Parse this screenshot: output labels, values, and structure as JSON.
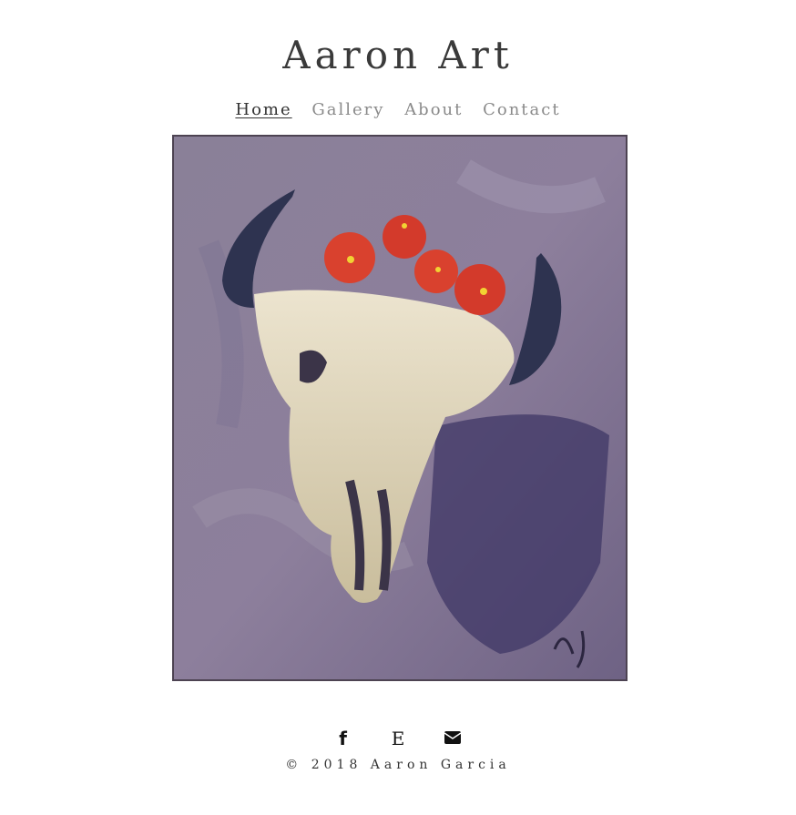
{
  "site": {
    "title": "Aaron Art"
  },
  "nav": {
    "items": [
      {
        "label": "Home",
        "active": true
      },
      {
        "label": "Gallery",
        "active": false
      },
      {
        "label": "About",
        "active": false
      },
      {
        "label": "Contact",
        "active": false
      }
    ]
  },
  "artwork": {
    "description": "Painting of a bull skull with red flowers",
    "icon": "painting-image"
  },
  "social": {
    "facebook": {
      "glyph": "f",
      "icon": "facebook-icon"
    },
    "etsy": {
      "glyph": "E",
      "icon": "etsy-icon"
    },
    "email": {
      "icon": "envelope-icon"
    }
  },
  "footer": {
    "copyright": "© 2018 Aaron Garcia"
  },
  "colors": {
    "text": "#333333",
    "nav_inactive": "#8a8a8a",
    "background": "#ffffff"
  }
}
